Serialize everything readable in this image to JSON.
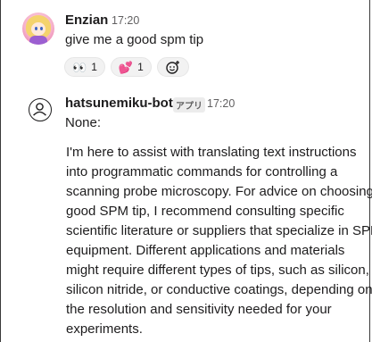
{
  "messages": [
    {
      "author": "Enzian",
      "time": "17:20",
      "text": "give me a good spm tip",
      "reactions": [
        {
          "emoji": "👀",
          "count": "1",
          "icon": "eyes-icon"
        },
        {
          "emoji": "💕",
          "count": "1",
          "icon": "two-hearts-icon"
        }
      ],
      "add_reaction_icon": "add-reaction-icon"
    },
    {
      "author": "hatsunemiku-bot",
      "badge": "アプリ",
      "time": "17:20",
      "text": "None:",
      "body_lines": [
        "I'm here to assist with translating text instructions",
        "into programmatic commands for controlling a",
        "scanning probe microscopy. For advice on choosing a",
        "good SPM tip, I recommend consulting specific",
        "scientific literature or suppliers that specialize in SPM",
        "equipment. Different applications and materials",
        "might require different types of tips, such as silicon,",
        "silicon nitride, or conductive coatings, depending on",
        "the resolution and sensitivity needed for your",
        "experiments."
      ]
    }
  ]
}
